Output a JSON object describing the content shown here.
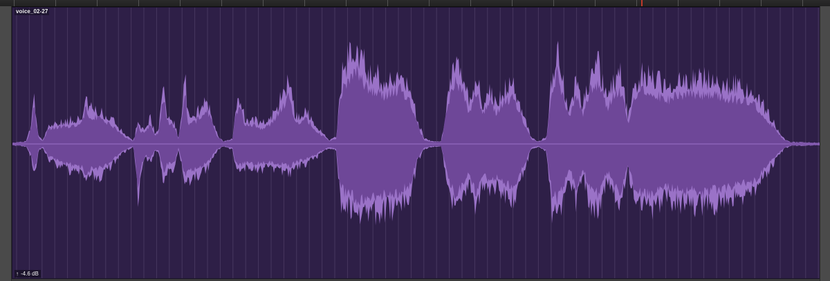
{
  "region": {
    "name": "voice_02-27",
    "gain_readout": "-4.6 dB"
  },
  "icons": {
    "gain_handle": "arrow-up-icon"
  },
  "colors": {
    "region_background": "#2e1f47",
    "waveform_fill": "#6e4798",
    "waveform_peak": "#9a72c7",
    "gridline": "#47375f"
  }
}
